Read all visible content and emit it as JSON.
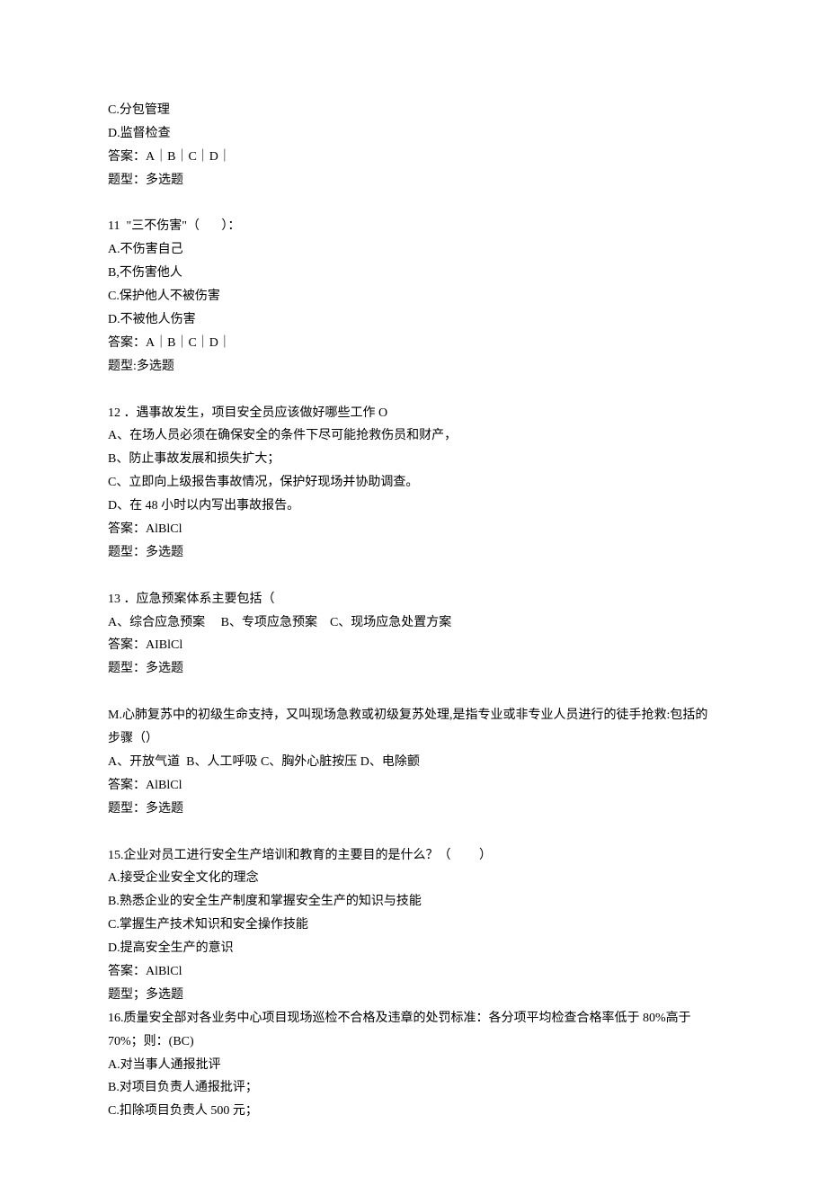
{
  "q10": {
    "optC": "C.分包管理",
    "optD": "D.监督检查",
    "answer": "答案：A｜B｜C｜D｜",
    "type": "题型：多选题"
  },
  "q11": {
    "title": "11  \"三不伤害\"（       ）：",
    "optA": "A.不伤害自己",
    "optB": "B,不伤害他人",
    "optC": "C.保护他人不被伤害",
    "optD": "D.不被他人伤害",
    "answer": "答案：A｜B｜C｜D｜",
    "type": "题型:多选题"
  },
  "q12": {
    "title": "12 ．遇事故发生，项目安全员应该做好哪些工作 O",
    "optA": "A、在场人员必须在确保安全的条件下尽可能抢救伤员和财产，",
    "optB": "B、防止事故发展和损失扩大；",
    "optC": "C、立即向上级报告事故情况，保护好现场并协助调查。",
    "optD": "D、在 48 小时以内写出事故报告。",
    "answer": "答案：AlBlCl",
    "type": "题型：多选题"
  },
  "q13": {
    "title": "13 ．应急预案体系主要包括（",
    "opts": "A、综合应急预案     B、专项应急预案    C、现场应急处置方案",
    "answer": "答案：AIBlCl",
    "type": "题型：多选题"
  },
  "q14": {
    "title": "M.心肺复苏中的初级生命支持，又叫现场急救或初级复苏处理,是指专业或非专业人员进行的徒手抢救:包括的步骤（）",
    "opts": "A、开放气道  B、人工呼吸 C、胸外心脏按压 D、电除颤",
    "answer": "答案：AlBlCl",
    "type": "题型：多选题"
  },
  "q15": {
    "title": "15.企业对员工进行安全生产培训和教育的主要目的是什么？（         ）",
    "optA": "A.接受企业安全文化的理念",
    "optB": "B.熟悉企业的安全生产制度和掌握安全生产的知识与技能",
    "optC": "C.掌握生产技术知识和安全操作技能",
    "optD": "D.提高安全生产的意识",
    "answer": "答案：AlBlCl",
    "type": "题型；多选题"
  },
  "q16": {
    "title": "16.质量安全部对各业务中心项目现场巡检不合格及违章的处罚标准：各分项平均检查合格率低于 80%高于 70%；则：(BC)",
    "optA": "A.对当事人通报批评",
    "optB": "B.对项目负责人通报批评；",
    "optC": "C.扣除项目负责人 500 元；"
  }
}
